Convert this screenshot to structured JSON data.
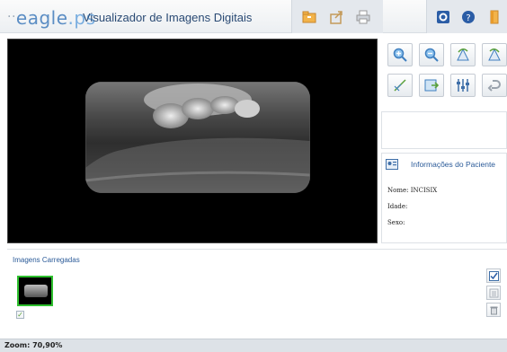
{
  "header": {
    "logo_main": "eagle",
    "logo_suffix": ".ps",
    "title": "Visualizador de Imagens Digitais"
  },
  "toolbar": [
    {
      "name": "open-folder-icon"
    },
    {
      "name": "export-icon"
    },
    {
      "name": "print-icon"
    },
    {
      "name": "settings-icon"
    },
    {
      "name": "help-icon"
    },
    {
      "name": "exit-door-icon"
    }
  ],
  "tools": [
    {
      "name": "zoom-in-icon"
    },
    {
      "name": "zoom-out-icon"
    },
    {
      "name": "rotate-left-icon"
    },
    {
      "name": "rotate-right-icon"
    },
    {
      "name": "measure-icon"
    },
    {
      "name": "export-image-icon"
    },
    {
      "name": "adjust-sliders-icon"
    },
    {
      "name": "undo-icon"
    }
  ],
  "patient": {
    "title": "Informações do Paciente",
    "name_line": "Nome: INCISIX",
    "age_line": "Idade:",
    "sex_line": "Sexo:"
  },
  "loaded": {
    "title": "Imagens Carregadas"
  },
  "status": {
    "zoom": "Zoom: 70,90%"
  },
  "colors": {
    "accent": "#2a5a98",
    "thumb_border": "#2ec02e"
  }
}
